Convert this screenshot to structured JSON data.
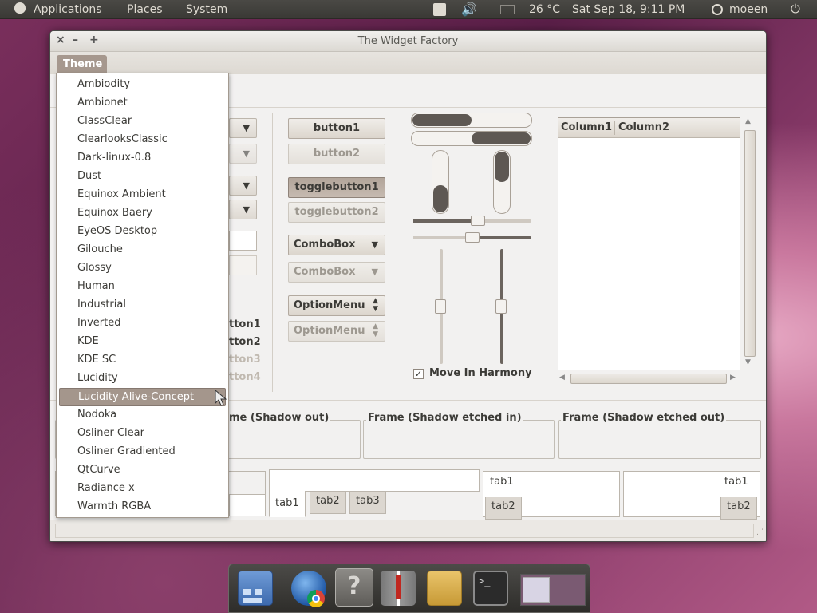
{
  "top_panel": {
    "menus": [
      "Applications",
      "Places",
      "System"
    ],
    "weather": "26 °C",
    "datetime": "Sat Sep 18,  9:11 PM",
    "user": "moeen",
    "icons": [
      "gnome-foot-icon",
      "dropbox-icon",
      "volume-icon",
      "mail-icon",
      "user-icon",
      "power-icon"
    ]
  },
  "window": {
    "title": "The Widget Factory",
    "controls": {
      "close": "×",
      "minimize": "–",
      "maximize": "+"
    },
    "menubar": {
      "theme_label": "Theme"
    }
  },
  "theme_menu": {
    "items": [
      "Ambiodity",
      "Ambionet",
      "ClassClear",
      "ClearlooksClassic",
      "Dark-linux-0.8",
      "Dust",
      "Equinox Ambient",
      "Equinox Baery",
      "EyeOS Desktop",
      "Gilouche",
      "Glossy",
      "Human",
      "Industrial",
      "Inverted",
      "KDE",
      "KDE SC",
      "Lucidity",
      "Lucidity Alive-Concept",
      "Nodoka",
      "Osliner Clear",
      "Osliner Gradiented",
      "QtCurve",
      "Radiance x",
      "Warmth RGBA"
    ],
    "highlighted": "Lucidity Alive-Concept"
  },
  "widgets": {
    "partial_radio_labels": [
      "tton1",
      "tton2",
      "tton3",
      "tton4"
    ],
    "button1": "button1",
    "button2": "button2",
    "togglebutton1": "togglebutton1",
    "togglebutton2": "togglebutton2",
    "combobox1": "ComboBox",
    "combobox2": "ComboBox",
    "optionmenu1": "OptionMenu",
    "optionmenu2": "OptionMenu",
    "move_in_harmony": "Move In Harmony",
    "progress": {
      "h1": 0.5,
      "h2": 0.5,
      "v1": 0.45,
      "v2": 0.5
    },
    "hscales": [
      0.55,
      0.5
    ],
    "vscales": [
      0.5,
      0.5
    ]
  },
  "tree": {
    "columns": [
      "Column1",
      "Column2"
    ]
  },
  "frames": {
    "f1": "me (Shadow out)",
    "f2": "Frame (Shadow etched in)",
    "f3": "Frame (Shadow etched out)"
  },
  "tabs": {
    "set1": [
      "tab1",
      "tab2",
      "tab3"
    ],
    "set2": [
      "tab1",
      "tab2"
    ],
    "set3": [
      "tab1",
      "tab2"
    ]
  },
  "colors": {
    "accent": "#a4968c",
    "window_bg": "#f2f1f0",
    "panel": "#3c3b37"
  }
}
